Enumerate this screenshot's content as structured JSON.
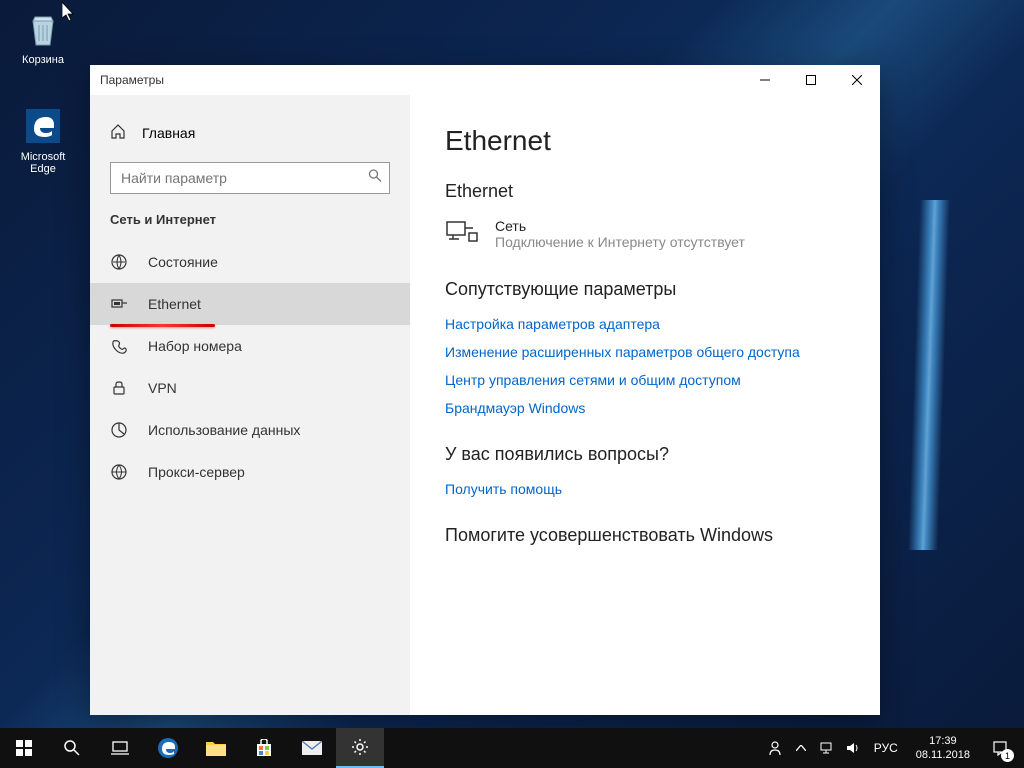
{
  "desktop": {
    "icons": {
      "recycle_bin": "Корзина",
      "edge": "Microsoft Edge"
    }
  },
  "window": {
    "title": "Параметры"
  },
  "sidebar": {
    "home": "Главная",
    "search_placeholder": "Найти параметр",
    "category": "Сеть и Интернет",
    "items": [
      {
        "label": "Состояние",
        "icon": "status"
      },
      {
        "label": "Ethernet",
        "icon": "ethernet"
      },
      {
        "label": "Набор номера",
        "icon": "dialup"
      },
      {
        "label": "VPN",
        "icon": "vpn"
      },
      {
        "label": "Использование данных",
        "icon": "data"
      },
      {
        "label": "Прокси-сервер",
        "icon": "proxy"
      }
    ]
  },
  "content": {
    "title": "Ethernet",
    "section1": "Ethernet",
    "network": {
      "name": "Сеть",
      "status": "Подключение к Интернету отсутствует"
    },
    "related_title": "Сопутствующие параметры",
    "links": [
      "Настройка параметров адаптера",
      "Изменение расширенных параметров общего доступа",
      "Центр управления сетями и общим доступом",
      "Брандмауэр Windows"
    ],
    "help_title": "У вас появились вопросы?",
    "help_link": "Получить помощь",
    "feedback_title": "Помогите усовершенствовать Windows"
  },
  "taskbar": {
    "lang": "РУС",
    "time": "17:39",
    "date": "08.11.2018",
    "notif_count": "1"
  }
}
